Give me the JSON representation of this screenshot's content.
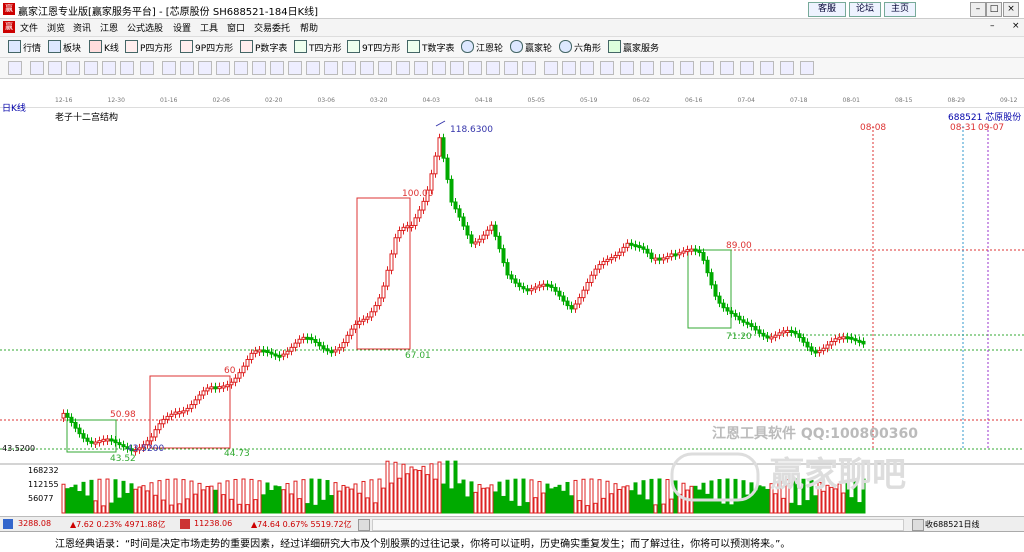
{
  "titlebar": {
    "title": "赢家江恩专业版[赢家服务平台] - [芯原股份  SH688521-184日K线]",
    "buttons": [
      "客服",
      "论坛",
      "主页"
    ],
    "logo": "赢"
  },
  "menu": [
    "文件",
    "浏览",
    "资讯",
    "江恩",
    "公式选股",
    "设置",
    "工具",
    "窗口",
    "交易委托",
    "帮助"
  ],
  "toolbar": [
    "行情",
    "板块",
    "K线",
    "P四方形",
    "9P四方形",
    "P数字表",
    "T四方形",
    "9T四方形",
    "T数字表",
    "江恩轮",
    "赢家轮",
    "六角形",
    "赢家服务"
  ],
  "chart": {
    "period_label": "日K线",
    "indicator_name": "老子十二宫结构",
    "stock_label": "688521  芯原股份",
    "date_ticks": [
      "12-16",
      "12-30",
      "01-16",
      "02-06",
      "02-20",
      "03-06",
      "03-20",
      "04-03",
      "04-18",
      "05-05",
      "05-19",
      "06-02",
      "06-16",
      "07-04",
      "07-18",
      "08-01",
      "08-15",
      "08-29",
      "09-12"
    ],
    "future_dates": [
      "08-08",
      "08-31",
      "09-07"
    ],
    "price_labels": [
      "118.6300",
      "100.00",
      "89.00",
      "71.20",
      "67.01",
      "60",
      "50.98",
      "44.73",
      "43.5200",
      "43.52"
    ],
    "y_axis_label": "43.5200",
    "volume_ticks": [
      "168232",
      "112155",
      "56077"
    ],
    "watermark": "江恩工具软件  QQ:100800360",
    "watermark_brand": "赢家聊吧"
  },
  "status": {
    "sh": "3288.08",
    "sh_change": "▲7.62 0.23% 4971.88亿",
    "sz": "11238.06",
    "sz_change": "▲74.64 0.67% 5519.72亿",
    "right": "收688521日线"
  },
  "quote": "江恩经典语录：“时间是决定市场走势的重要因素，经过详细研究大市及个别股票的过往记录，你将可以证明，历史确实重复发生；而了解过往，你将可以预测将来。”。"
}
